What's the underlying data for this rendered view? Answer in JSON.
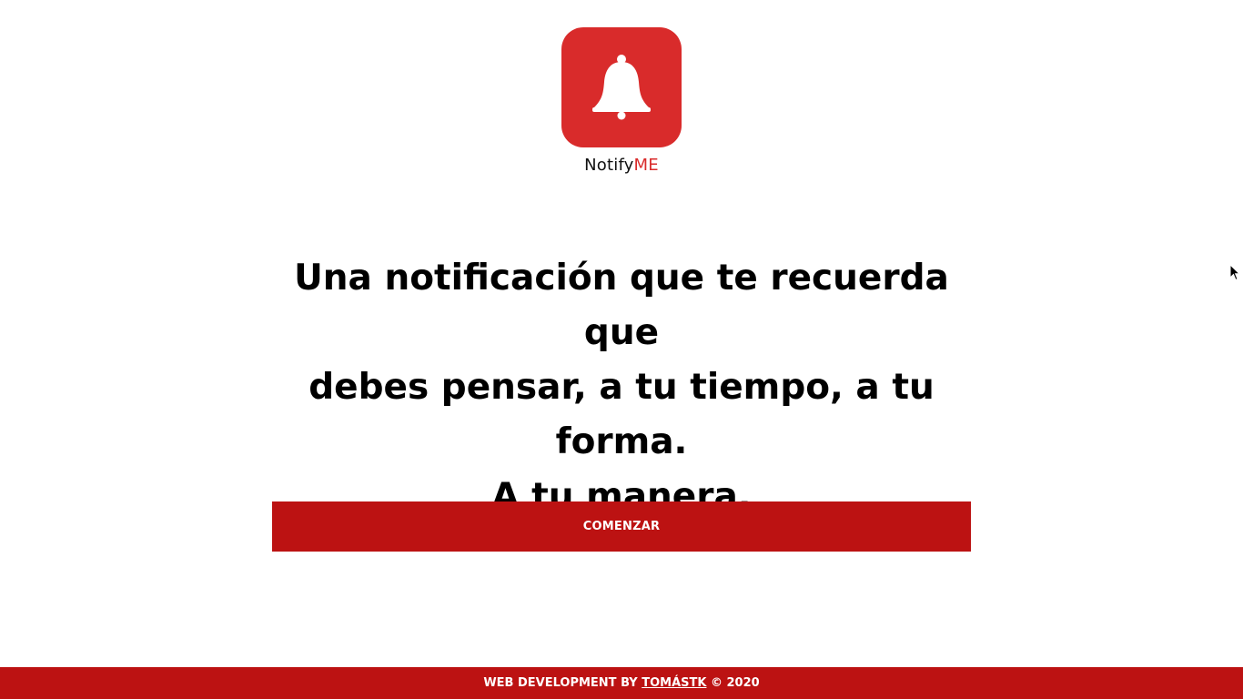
{
  "brand": {
    "name_part1": "Notify",
    "name_part2": "ME",
    "logo_icon": "bell-icon",
    "accent_color": "#d92b2b"
  },
  "hero": {
    "line1": "Una notificación que te recuerda que",
    "line2": "debes pensar, a tu tiempo, a tu",
    "line3": "forma.",
    "line4": "A tu manera."
  },
  "cta": {
    "label": "COMENZAR",
    "color": "#bc1212"
  },
  "footer": {
    "prefix": "WEB DEVELOPMENT BY ",
    "author": "TOMÁSTK",
    "suffix": " © 2020",
    "color": "#bc1212"
  }
}
